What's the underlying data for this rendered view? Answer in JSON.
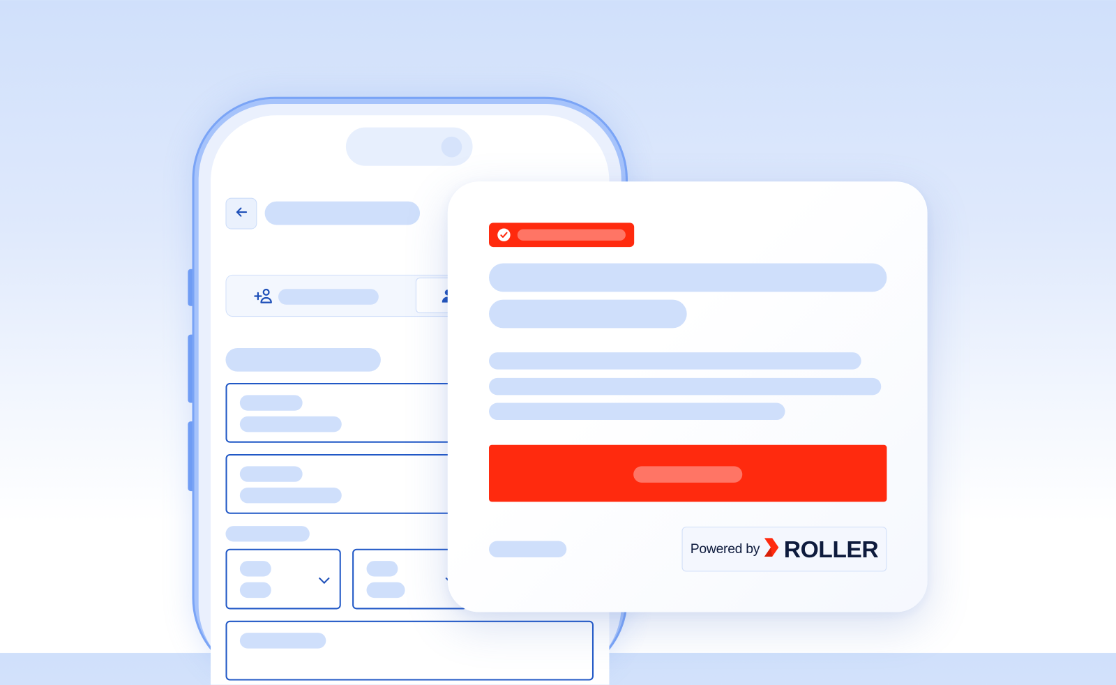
{
  "colors": {
    "background_top": "#d0e0fb",
    "phone_frame": "#7aa4f6",
    "placeholder_fill": "#cfdffb",
    "accent_blue": "#2158c6",
    "brand_red": "#ff2a0e",
    "brand_red_light": "#ff7565",
    "brand_navy": "#0e1b3d"
  },
  "phone": {
    "header": {
      "back_icon": "arrow-left-icon"
    },
    "segmented_control": {
      "add_guest_icon": "person-add-icon",
      "second_icon": "person-icon"
    },
    "form": {
      "fields": [
        {
          "type": "text-field"
        },
        {
          "type": "text-field"
        },
        {
          "type": "select",
          "icon": "chevron-down-icon"
        },
        {
          "type": "select",
          "icon": "chevron-down-icon"
        },
        {
          "type": "text-field"
        }
      ]
    }
  },
  "card": {
    "badge": {
      "icon": "check-circle-icon"
    },
    "cta": {},
    "powered_by": {
      "label": "Powered by",
      "brand": "ROLLER",
      "logo_icon": "roller-chevron-icon"
    }
  }
}
